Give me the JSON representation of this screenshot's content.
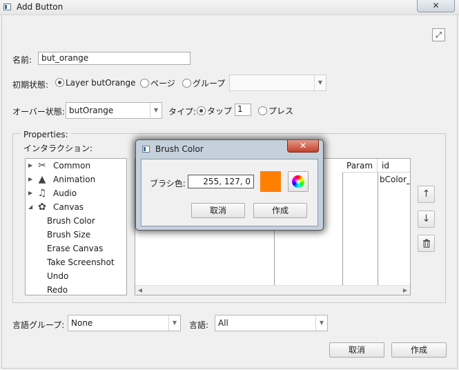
{
  "window": {
    "title": "Add Button",
    "close_glyph": "✕"
  },
  "form": {
    "name_label": "名前:",
    "name_value": "but_orange",
    "initial_state_label": "初期状態:",
    "radio_layer": "Layer butOrange",
    "radio_page": "ページ",
    "radio_group": "グループ",
    "over_state_label": "オーバー状態:",
    "over_state_value": "butOrange",
    "type_label": "タイプ:",
    "radio_tap": "タップ",
    "tap_count": "1",
    "radio_press": "プレス"
  },
  "properties": {
    "title": "Properties:",
    "interaction_label": "インタラクション:",
    "tree": [
      {
        "label": "Common",
        "icon": "tools-icon",
        "arrow": "▶"
      },
      {
        "label": "Animation",
        "icon": "animation-icon",
        "arrow": "▶"
      },
      {
        "label": "Audio",
        "icon": "audio-icon",
        "arrow": "▶"
      },
      {
        "label": "Canvas",
        "icon": "canvas-icon",
        "arrow": "◢"
      },
      {
        "label": "Brush Color"
      },
      {
        "label": "Brush Size"
      },
      {
        "label": "Erase Canvas"
      },
      {
        "label": "Take Screenshot"
      },
      {
        "label": "Undo"
      },
      {
        "label": "Redo"
      }
    ],
    "columns": {
      "param": "Param",
      "id": "id"
    },
    "selected_id": "bColor_("
  },
  "footer": {
    "language_group_label": "言語グループ:",
    "language_group_value": "None",
    "language_label": "言語:",
    "language_value": "All",
    "cancel": "取消",
    "create": "作成"
  },
  "dialog": {
    "title": "Brush Color",
    "close_glyph": "✕",
    "brush_color_label": "ブラシ色:",
    "brush_color_value": "255, 127, 0",
    "swatch_color": "#ff7f00",
    "cancel": "取消",
    "create": "作成"
  }
}
